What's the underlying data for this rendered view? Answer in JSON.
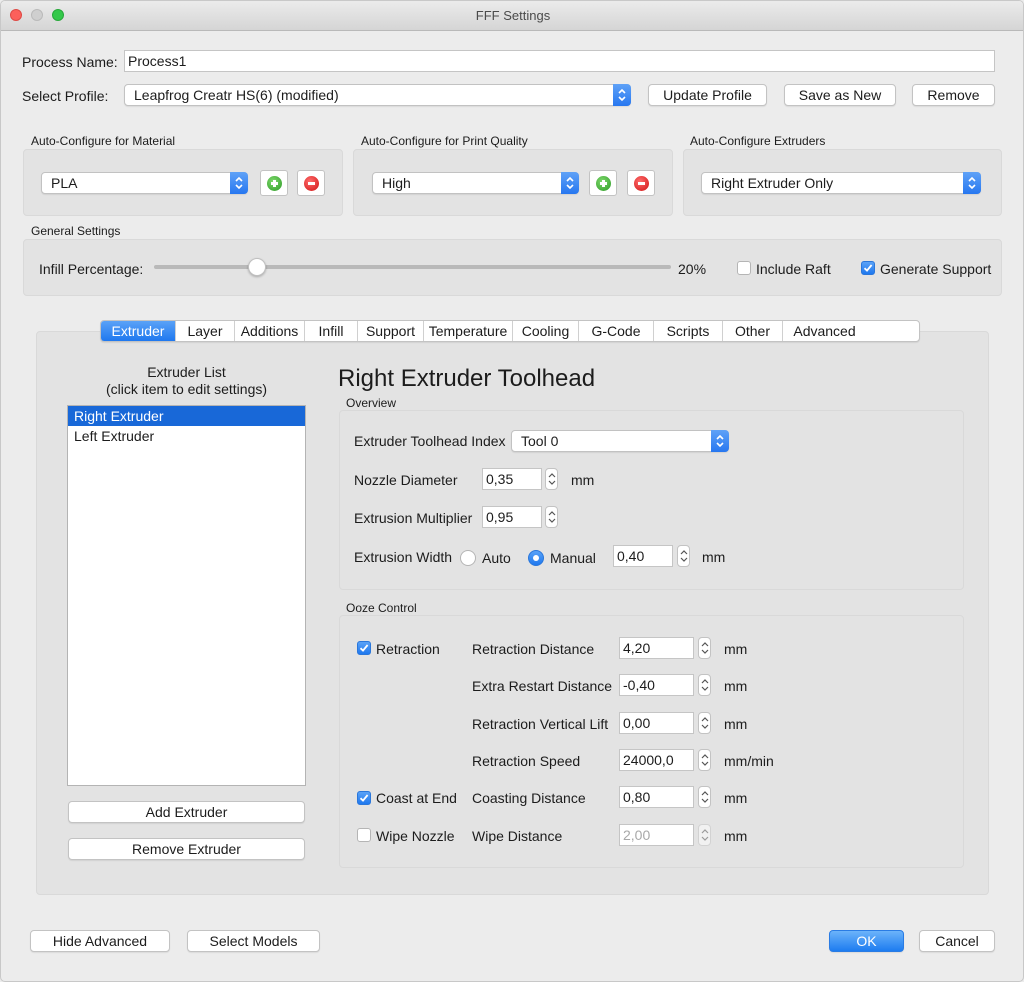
{
  "window": {
    "title": "FFF Settings"
  },
  "process": {
    "name_label": "Process Name:",
    "name_value": "Process1"
  },
  "profile": {
    "label": "Select Profile:",
    "selected": "Leapfrog Creatr HS(6) (modified)",
    "update_label": "Update Profile",
    "save_new_label": "Save as New",
    "remove_label": "Remove"
  },
  "auto_material": {
    "title": "Auto-Configure for Material",
    "selected": "PLA"
  },
  "auto_quality": {
    "title": "Auto-Configure for Print Quality",
    "selected": "High"
  },
  "auto_extruders": {
    "title": "Auto-Configure Extruders",
    "selected": "Right Extruder Only"
  },
  "general": {
    "title": "General Settings",
    "infill_label": "Infill Percentage:",
    "infill_value_text": "20%",
    "infill_fraction": 0.2,
    "include_raft_label": "Include Raft",
    "include_raft_checked": false,
    "generate_support_label": "Generate Support",
    "generate_support_checked": true
  },
  "tabs": [
    "Extruder",
    "Layer",
    "Additions",
    "Infill",
    "Support",
    "Temperature",
    "Cooling",
    "G-Code",
    "Scripts",
    "Other",
    "Advanced"
  ],
  "extruder_list": {
    "title_line1": "Extruder List",
    "title_line2": "(click item to edit settings)",
    "items": [
      "Right Extruder",
      "Left Extruder"
    ],
    "add_label": "Add Extruder",
    "remove_label": "Remove Extruder"
  },
  "toolhead": {
    "heading": "Right Extruder Toolhead",
    "overview_title": "Overview",
    "index_label": "Extruder Toolhead Index",
    "index_selected": "Tool 0",
    "nozzle_label": "Nozzle Diameter",
    "nozzle_value": "0,35",
    "nozzle_unit": "mm",
    "multiplier_label": "Extrusion Multiplier",
    "multiplier_value": "0,95",
    "width_label": "Extrusion Width",
    "width_auto_label": "Auto",
    "width_manual_label": "Manual",
    "width_value": "0,40",
    "width_unit": "mm"
  },
  "ooze": {
    "title": "Ooze Control",
    "retraction_label": "Retraction",
    "retraction_checked": true,
    "retraction_distance_label": "Retraction Distance",
    "retraction_distance_value": "4,20",
    "extra_restart_label": "Extra Restart Distance",
    "extra_restart_value": "-0,40",
    "vertical_lift_label": "Retraction Vertical Lift",
    "vertical_lift_value": "0,00",
    "retraction_speed_label": "Retraction Speed",
    "retraction_speed_value": "24000,0",
    "coast_label": "Coast at End",
    "coast_checked": true,
    "coasting_distance_label": "Coasting Distance",
    "coasting_distance_value": "0,80",
    "wipe_label": "Wipe Nozzle",
    "wipe_checked": false,
    "wipe_distance_label": "Wipe Distance",
    "wipe_distance_value": "2,00",
    "unit_mm": "mm",
    "unit_speed": "mm/min"
  },
  "footer": {
    "hide_advanced_label": "Hide Advanced",
    "select_models_label": "Select Models",
    "ok_label": "OK",
    "cancel_label": "Cancel"
  }
}
